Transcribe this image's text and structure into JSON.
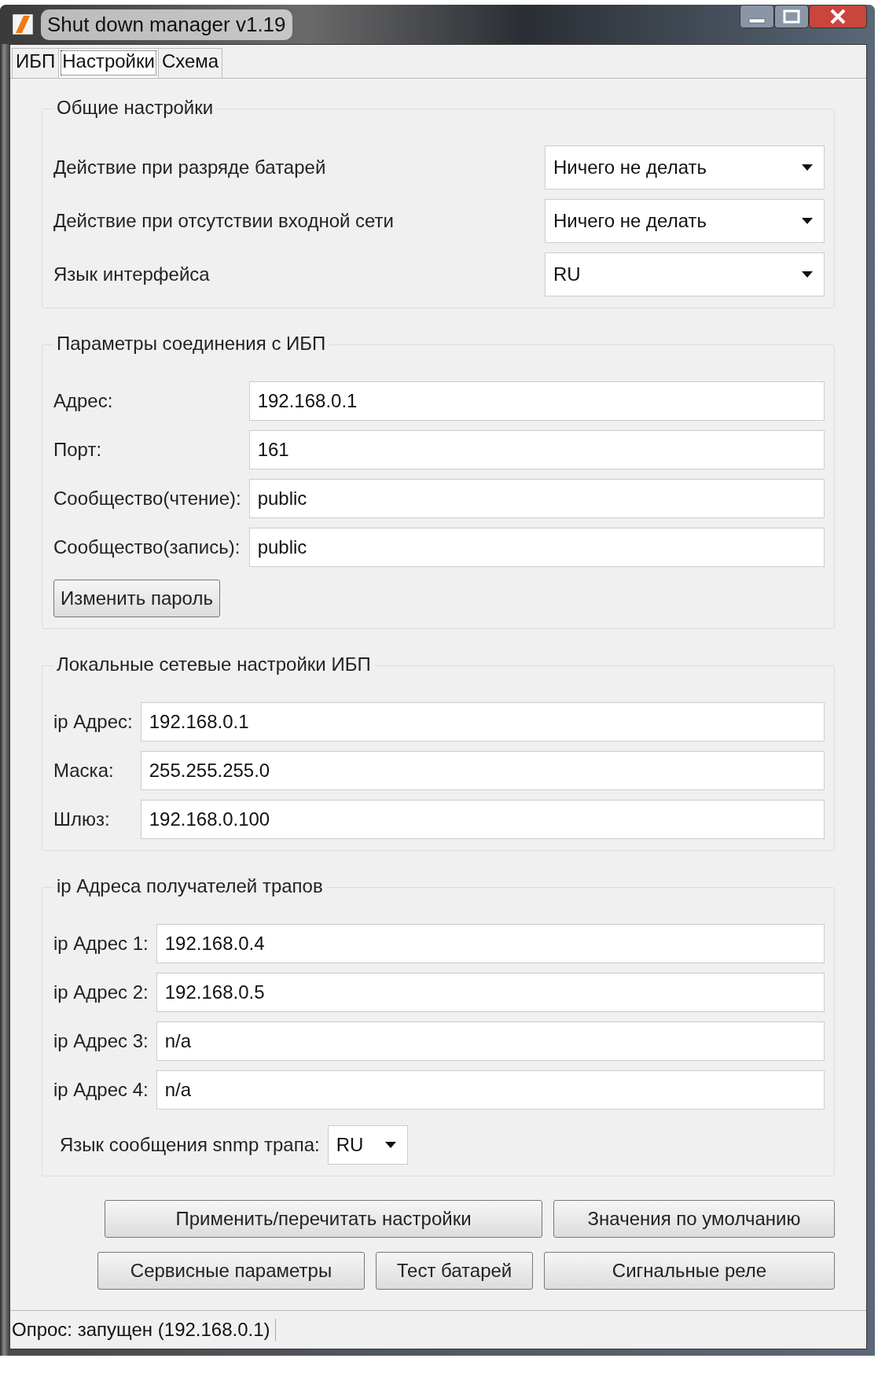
{
  "window": {
    "title": "Shut down manager  v1.19"
  },
  "tabs": [
    {
      "label": "ИБП",
      "selected": false
    },
    {
      "label": "Настройки",
      "selected": true
    },
    {
      "label": "Схема",
      "selected": false
    }
  ],
  "groups": [
    {
      "title": "Общие настройки",
      "rows": [
        {
          "kind": "combo",
          "label": "Действие при разряде батарей",
          "value": "Ничего не делать"
        },
        {
          "kind": "combo",
          "label": "Действие при отсутствии входной сети",
          "value": "Ничего не делать"
        },
        {
          "kind": "combo",
          "label": "Язык интерфейса",
          "value": "RU"
        }
      ]
    },
    {
      "title": "Параметры соединения с ИБП",
      "rows": [
        {
          "kind": "field",
          "label": "Адрес:",
          "value": "192.168.0.1"
        },
        {
          "kind": "field",
          "label": "Порт:",
          "value": "161"
        },
        {
          "kind": "field",
          "label": "Сообщество(чтение):",
          "value": "public"
        },
        {
          "kind": "field",
          "label": "Сообщество(запись):",
          "value": "public"
        },
        {
          "kind": "button",
          "label": "Изменить пароль"
        }
      ]
    },
    {
      "title": "Локальные сетевые настройки ИБП",
      "rows": [
        {
          "kind": "field",
          "label": "ip Адрес:",
          "value": "192.168.0.1"
        },
        {
          "kind": "field",
          "label": "Маска:",
          "value": "255.255.255.0"
        },
        {
          "kind": "field",
          "label": "Шлюз:",
          "value": "192.168.0.100"
        }
      ]
    },
    {
      "title": "ip Адреса получателей трапов",
      "rows": [
        {
          "kind": "field",
          "label": "ip Адрес 1:",
          "value": "192.168.0.4"
        },
        {
          "kind": "field",
          "label": "ip Адрес 2:",
          "value": "192.168.0.5"
        },
        {
          "kind": "field",
          "label": "ip Адрес 3:",
          "value": "n/a"
        },
        {
          "kind": "field",
          "label": "ip Адрес 4:",
          "value": "n/a"
        },
        {
          "kind": "small_combo",
          "label": "Язык сообщения snmp трапа:",
          "value": "RU"
        }
      ]
    }
  ],
  "buttons": [
    [
      {
        "label": "Применить/перечитать настройки"
      },
      {
        "label": "Значения по умолчанию"
      }
    ],
    [
      {
        "label": "Сервисные параметры"
      },
      {
        "label": "Тест батарей"
      },
      {
        "label": "Сигнальные реле"
      }
    ]
  ],
  "status_bar": {
    "text": "Опрос: запущен (192.168.0.1)"
  }
}
